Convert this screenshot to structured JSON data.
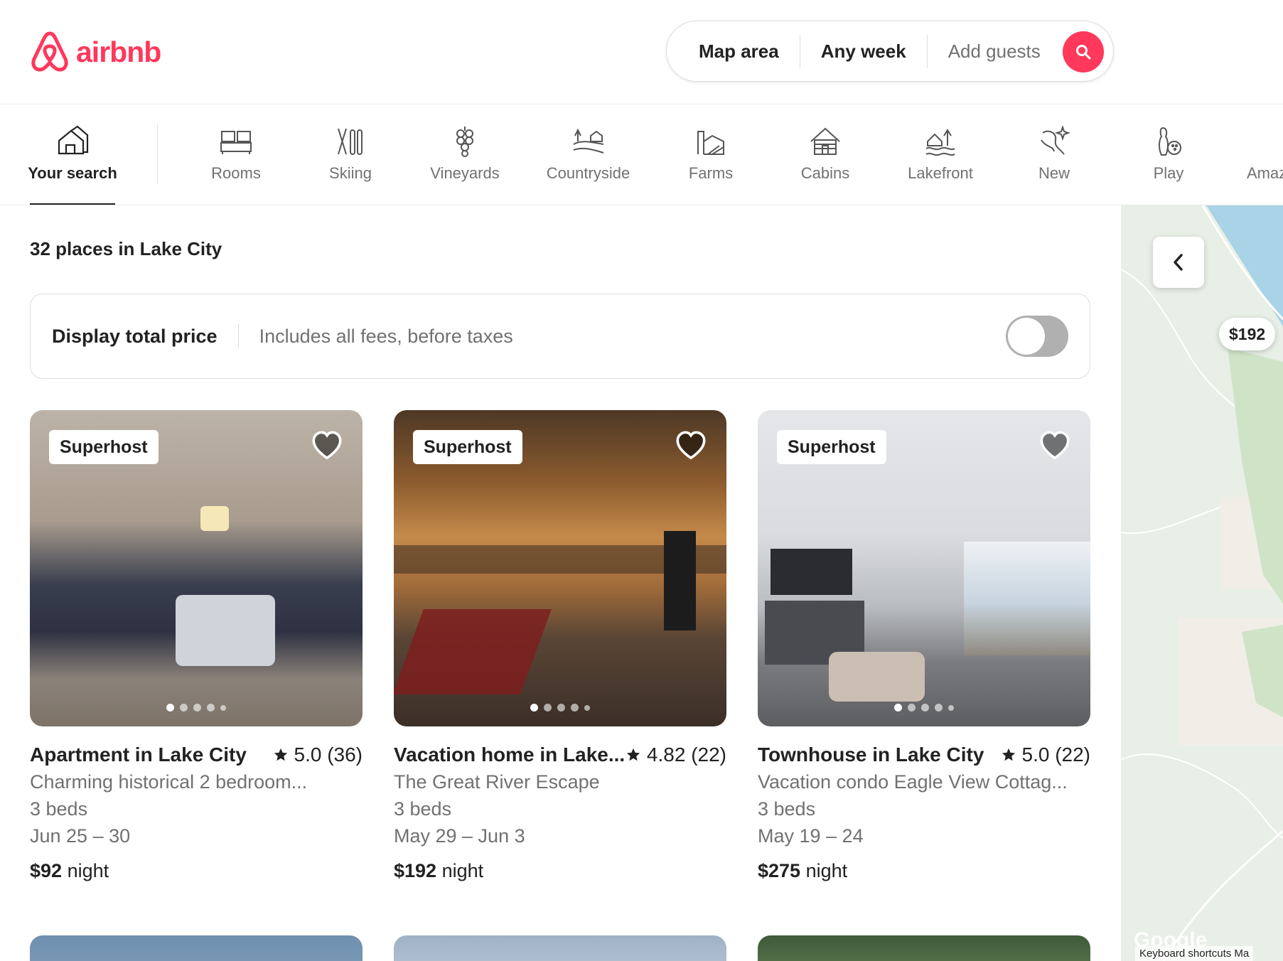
{
  "brand": {
    "name": "airbnb",
    "color": "#ff385c"
  },
  "search": {
    "location": "Map area",
    "dates": "Any week",
    "guests_placeholder": "Add guests",
    "button_icon": "search-icon"
  },
  "categories": [
    {
      "label": "Your search",
      "icon": "home-search-icon",
      "active": true
    },
    {
      "label": "Rooms",
      "icon": "bed-icon"
    },
    {
      "label": "Skiing",
      "icon": "skis-icon"
    },
    {
      "label": "Vineyards",
      "icon": "grapes-icon"
    },
    {
      "label": "Countryside",
      "icon": "countryside-icon"
    },
    {
      "label": "Farms",
      "icon": "barn-icon"
    },
    {
      "label": "Cabins",
      "icon": "cabin-icon"
    },
    {
      "label": "Lakefront",
      "icon": "lakefront-icon"
    },
    {
      "label": "New",
      "icon": "new-sparkle-icon"
    },
    {
      "label": "Play",
      "icon": "bowling-icon"
    },
    {
      "label": "Amaz",
      "icon": "amazing-icon"
    }
  ],
  "results": {
    "count_text": "32 places in Lake City"
  },
  "price_toggle": {
    "title": "Display total price",
    "subtitle": "Includes all fees, before taxes",
    "on": false
  },
  "listings": [
    {
      "badge": "Superhost",
      "title": "Apartment in Lake City",
      "rating": "5.0 (36)",
      "subtitle": "Charming historical 2 bedroom...",
      "beds": "3 beds",
      "dates": "Jun 25 – 30",
      "price": "$92",
      "price_unit": "night",
      "photo_colors": [
        "#8d7b6a",
        "#2d3142",
        "#cfc8bf"
      ]
    },
    {
      "badge": "Superhost",
      "title": "Vacation home in Lake...",
      "rating": "4.82 (22)",
      "subtitle": "The Great River Escape",
      "beds": "3 beds",
      "dates": "May 29 – Jun 3",
      "price": "$192",
      "price_unit": "night",
      "photo_colors": [
        "#a0652c",
        "#4a3522",
        "#d9a25e"
      ]
    },
    {
      "badge": "Superhost",
      "title": "Townhouse in Lake City",
      "rating": "5.0 (22)",
      "subtitle": "Vacation condo Eagle View Cottag...",
      "beds": "3 beds",
      "dates": "May 19 – 24",
      "price": "$275",
      "price_unit": "night",
      "photo_colors": [
        "#d6d8db",
        "#4b4b50",
        "#9a9ea3"
      ]
    }
  ],
  "map": {
    "price_pin": "$192",
    "footer_text": "Keyboard shortcuts   Ma",
    "attribution": "Google"
  }
}
